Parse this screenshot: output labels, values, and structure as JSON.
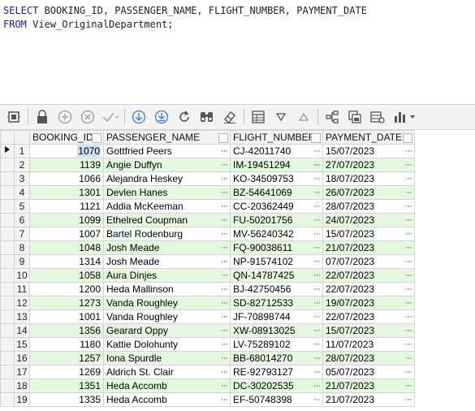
{
  "sql": {
    "line1_kw": "SELECT",
    "line1_rest": " BOOKING_ID, PASSENGER_NAME, FLIGHT_NUMBER, PAYMENT_DATE",
    "line2_kw": "FROM",
    "line2_rest": " View_OriginalDepartment;"
  },
  "columns": [
    "BOOKING_ID",
    "PASSENGER_NAME",
    "FLIGHT_NUMBER",
    "PAYMENT_DATE"
  ],
  "ellipsis": "···",
  "rows": [
    {
      "n": "1",
      "id": "1070",
      "name": "Gottfried Peers",
      "flight": "CJ-42011740",
      "date": "15/07/2023"
    },
    {
      "n": "2",
      "id": "1139",
      "name": "Angie Duffyn",
      "flight": "IM-19451294",
      "date": "27/07/2023"
    },
    {
      "n": "3",
      "id": "1066",
      "name": "Alejandra Heskey",
      "flight": "KO-34509753",
      "date": "18/07/2023"
    },
    {
      "n": "4",
      "id": "1301",
      "name": "Devlen Hanes",
      "flight": "BZ-54641069",
      "date": "26/07/2023"
    },
    {
      "n": "5",
      "id": "1121",
      "name": "Addia McKeeman",
      "flight": "CC-20362449",
      "date": "28/07/2023"
    },
    {
      "n": "6",
      "id": "1099",
      "name": "Ethelred Coupman",
      "flight": "FU-50201756",
      "date": "24/07/2023"
    },
    {
      "n": "7",
      "id": "1007",
      "name": "Bartel Rodenburg",
      "flight": "MV-56240342",
      "date": "15/07/2023"
    },
    {
      "n": "8",
      "id": "1048",
      "name": "Josh Meade",
      "flight": "FQ-90038611",
      "date": "21/07/2023"
    },
    {
      "n": "9",
      "id": "1314",
      "name": "Josh Meade",
      "flight": "NP-91574102",
      "date": "07/07/2023"
    },
    {
      "n": "10",
      "id": "1058",
      "name": "Aura Dinjes",
      "flight": "QN-14787425",
      "date": "22/07/2023"
    },
    {
      "n": "11",
      "id": "1200",
      "name": "Heda Mallinson",
      "flight": "BJ-42750456",
      "date": "22/07/2023"
    },
    {
      "n": "12",
      "id": "1273",
      "name": "Vanda Roughley",
      "flight": "SD-82712533",
      "date": "19/07/2023"
    },
    {
      "n": "13",
      "id": "1001",
      "name": "Vanda Roughley",
      "flight": "JF-70898744",
      "date": "22/07/2023"
    },
    {
      "n": "14",
      "id": "1356",
      "name": "Gearard Oppy",
      "flight": "XW-08913025",
      "date": "15/07/2023"
    },
    {
      "n": "15",
      "id": "1180",
      "name": "Kattie Dolohunty",
      "flight": "LV-75289102",
      "date": "11/07/2023"
    },
    {
      "n": "16",
      "id": "1257",
      "name": "Iona Spurdle",
      "flight": "BB-68014270",
      "date": "28/07/2023"
    },
    {
      "n": "17",
      "id": "1269",
      "name": "Aldrich St. Clair",
      "flight": "RE-92793127",
      "date": "05/07/2023"
    },
    {
      "n": "18",
      "id": "1351",
      "name": "Heda Accomb",
      "flight": "DC-30202535",
      "date": "21/07/2023"
    },
    {
      "n": "19",
      "id": "1335",
      "name": "Heda Accomb",
      "flight": "EF-50748398",
      "date": "21/07/2023"
    }
  ],
  "toolbar_icons": [
    "grid-settings-icon",
    "lock-icon",
    "add-icon",
    "cancel-icon",
    "check-icon",
    "fetch-next-icon",
    "fetch-all-icon",
    "refresh-icon",
    "find-icon",
    "clear-icon",
    "export-icon",
    "filter-down-icon",
    "filter-up-icon",
    "tree-icon",
    "save-icon",
    "grid-options-icon",
    "chart-icon"
  ],
  "colors": {
    "even_row": "#e4f8e0",
    "selected_cell": "#c9ddf3",
    "keyword": "#1a1ab0"
  }
}
